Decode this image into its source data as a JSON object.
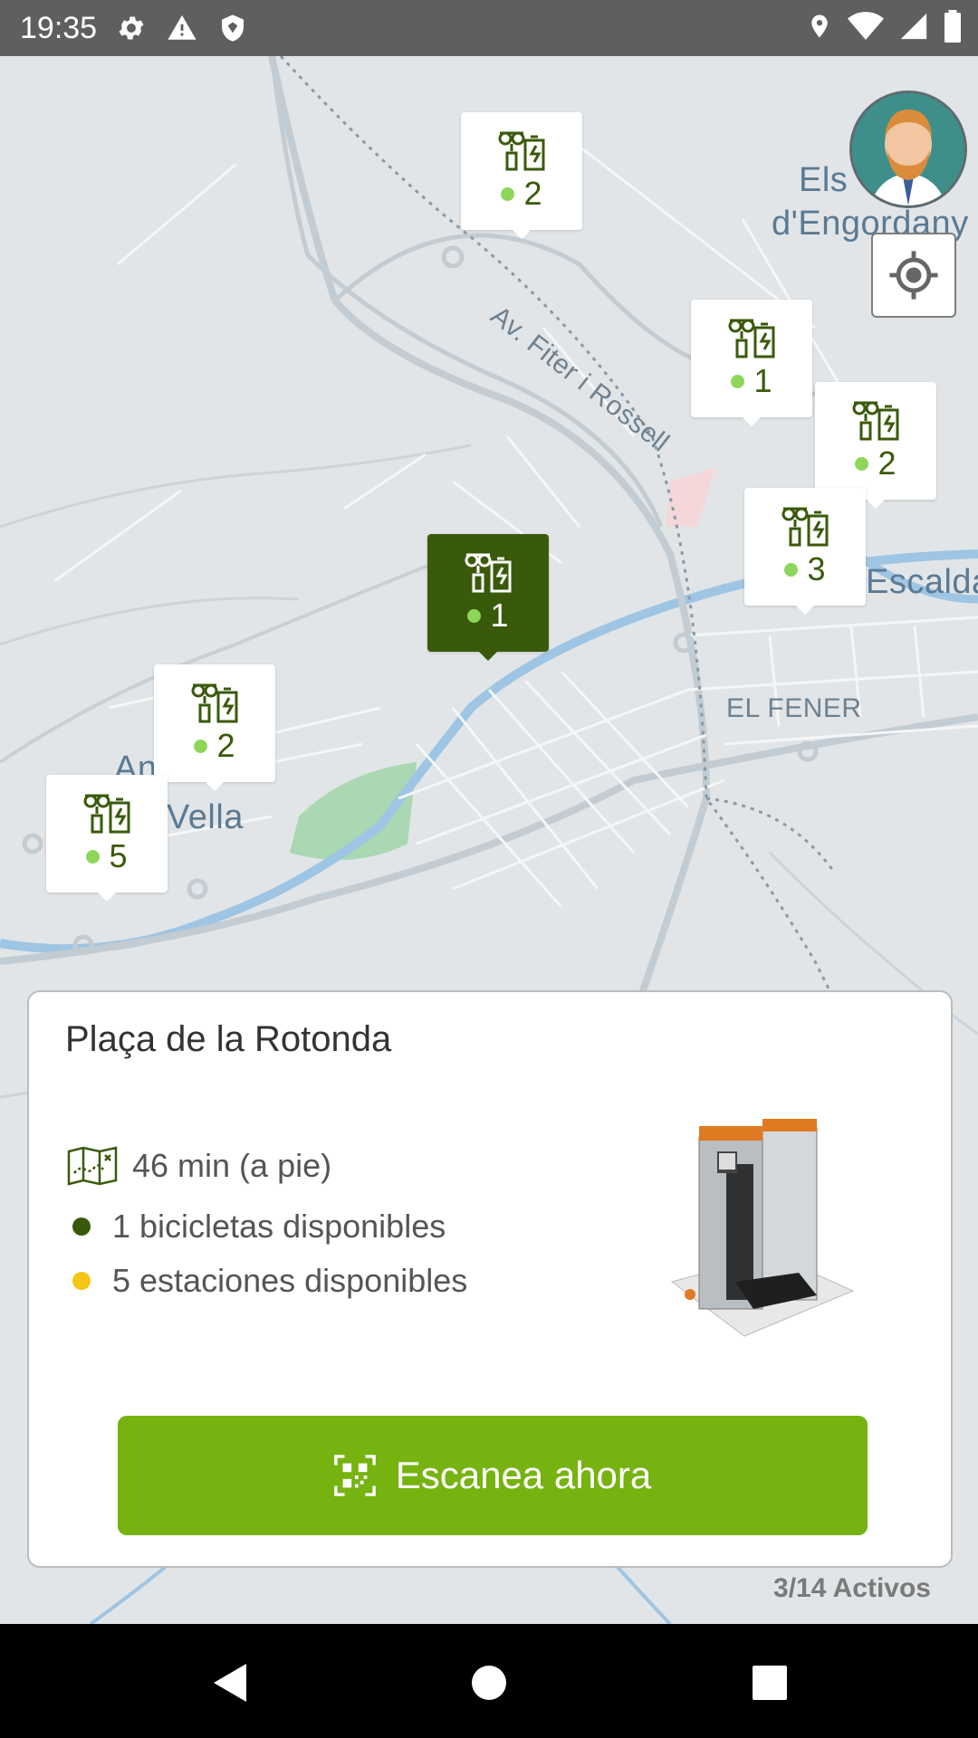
{
  "status_bar": {
    "time": "19:35",
    "left_icons": [
      "settings-icon",
      "warning-icon",
      "shield-icon"
    ],
    "right_icons": [
      "location-icon",
      "wifi-icon",
      "signal-icon",
      "battery-icon"
    ]
  },
  "map": {
    "labels": {
      "engordany_1": "Els",
      "engordany_2": "d'Engordany",
      "street": "Av. Fiter i Rossell",
      "escaldes": "Escalda",
      "el_fener": "EL FENER",
      "andorra_1": "Andorra",
      "andorra_2": "Vella"
    },
    "markers": [
      {
        "count": "2",
        "active": false
      },
      {
        "count": "1",
        "active": false
      },
      {
        "count": "2",
        "active": false
      },
      {
        "count": "3",
        "active": false
      },
      {
        "count": "1",
        "active": true
      },
      {
        "count": "2",
        "active": false
      },
      {
        "count": "5",
        "active": false
      }
    ],
    "marker_dot_color": "#8ed65a",
    "active_marker_color": "#3a5a0b"
  },
  "card": {
    "station_name": "Plaça de la Rotonda",
    "walk_time": "46 min (a pie)",
    "bikes_available": "1 bicicletas disponibles",
    "stations_available": "5 estaciones disponibles",
    "bikes_bullet_color": "#3a5a0b",
    "stations_bullet_color": "#f5c518",
    "scan_button": "Escanea ahora",
    "scan_button_color": "#76b310"
  },
  "footer": {
    "active_count": "3/14 Activos"
  },
  "nav": {
    "back": "back-icon",
    "home": "home-icon",
    "recents": "recents-icon"
  }
}
